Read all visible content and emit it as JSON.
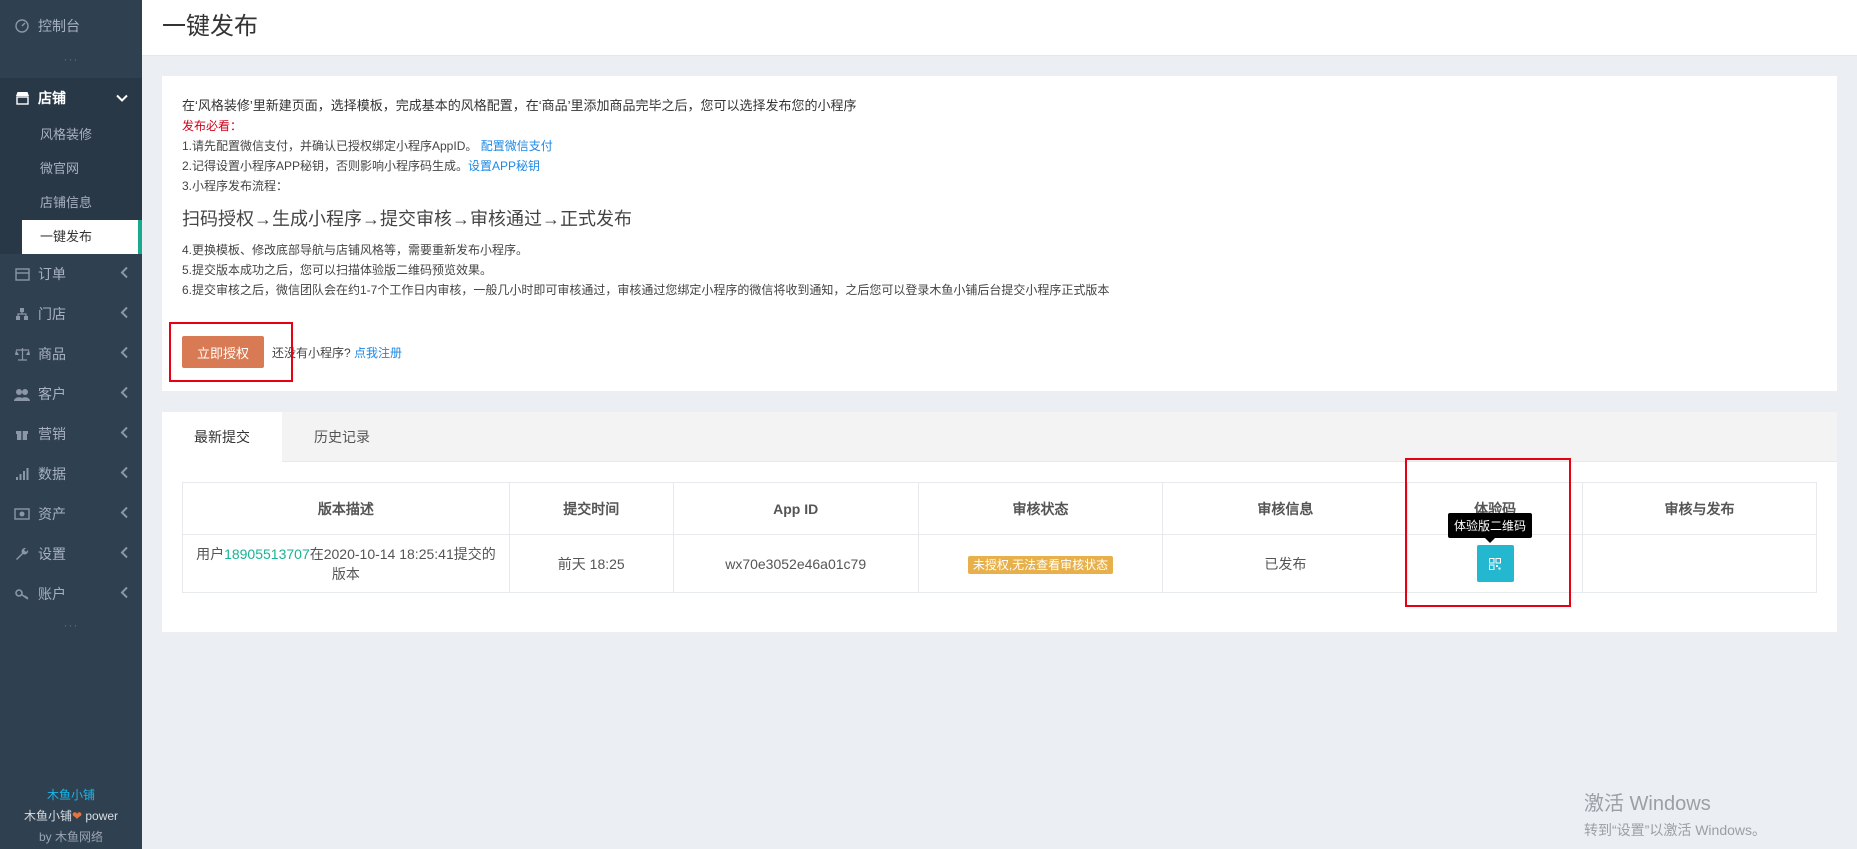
{
  "sidebar": {
    "top_item": {
      "label": "控制台",
      "icon": "dashboard-icon"
    },
    "dots": "···",
    "open_item": {
      "label": "店铺",
      "icon": "store-icon"
    },
    "sub_items": [
      {
        "label": "风格装修"
      },
      {
        "label": "微官网"
      },
      {
        "label": "店铺信息"
      },
      {
        "label": "一键发布",
        "active": true
      }
    ],
    "items": [
      {
        "label": "订单",
        "icon": "order-icon"
      },
      {
        "label": "门店",
        "icon": "branch-icon"
      },
      {
        "label": "商品",
        "icon": "scale-icon"
      },
      {
        "label": "客户",
        "icon": "users-icon"
      },
      {
        "label": "营销",
        "icon": "gift-icon"
      },
      {
        "label": "数据",
        "icon": "chart-icon"
      },
      {
        "label": "资产",
        "icon": "money-icon"
      },
      {
        "label": "设置",
        "icon": "wrench-icon"
      },
      {
        "label": "账户",
        "icon": "key-icon"
      }
    ],
    "footer": {
      "brand": "木鱼小铺",
      "power_prefix": "木鱼小铺",
      "power_suffix": " power",
      "by": "by 木鱼网络"
    }
  },
  "header": {
    "title": "一键发布"
  },
  "info": {
    "intro": "在‘风格装修’里新建页面，选择模板，完成基本的风格配置，在‘商品’里添加商品完毕之后，您可以选择发布您的小程序",
    "must_read": "发布必看：",
    "step1_text": "1.请先配置微信支付，并确认已授权绑定小程序AppID。 ",
    "step1_link": "配置微信支付",
    "step2_text": "2.记得设置小程序APP秘钥，否则影响小程序码生成。",
    "step2_link": "设置APP秘钥",
    "step3": "3.小程序发布流程：",
    "flow": "扫码授权→生成小程序→提交审核→审核通过→正式发布",
    "step4": "4.更换模板、修改底部导航与店铺风格等，需要重新发布小程序。",
    "step5": "5.提交版本成功之后，您可以扫描体验版二维码预览效果。",
    "step6": "6.提交审核之后，微信团队会在约1-7个工作日内审核，一般几小时即可审核通过，审核通过您绑定小程序的微信将收到通知，之后您可以登录木鱼小铺后台提交小程序正式版本",
    "auth_button": "立即授权",
    "no_app_tip": "还没有小程序?",
    "register_link": "点我注册"
  },
  "tabs": [
    {
      "label": "最新提交",
      "active": true
    },
    {
      "label": "历史记录",
      "active": false
    }
  ],
  "table": {
    "headers": [
      "版本描述",
      "提交时间",
      "App ID",
      "审核状态",
      "审核信息",
      "体验码",
      "审核与发布"
    ],
    "rows": [
      {
        "desc_prefix": "用户",
        "desc_phone": "18905513707",
        "desc_suffix": "在2020-10-14 18:25:41提交的版本",
        "time": "前天 18:25",
        "app_id": "wx70e3052e46a01c79",
        "status": "未授权,无法查看审核状态",
        "info": "已发布",
        "qr_icon": "qrcode-icon",
        "publish": ""
      }
    ]
  },
  "tooltip": "体验版二维码",
  "watermark": {
    "line1": "激活 Windows",
    "line2": "转到“设置”以激活 Windows。"
  },
  "colors": {
    "accent": "#19aa8d",
    "auth_button": "#d87b54",
    "status_badge": "#e8b04a",
    "qr_button": "#23b7d0",
    "highlight_box": "#e60012"
  }
}
